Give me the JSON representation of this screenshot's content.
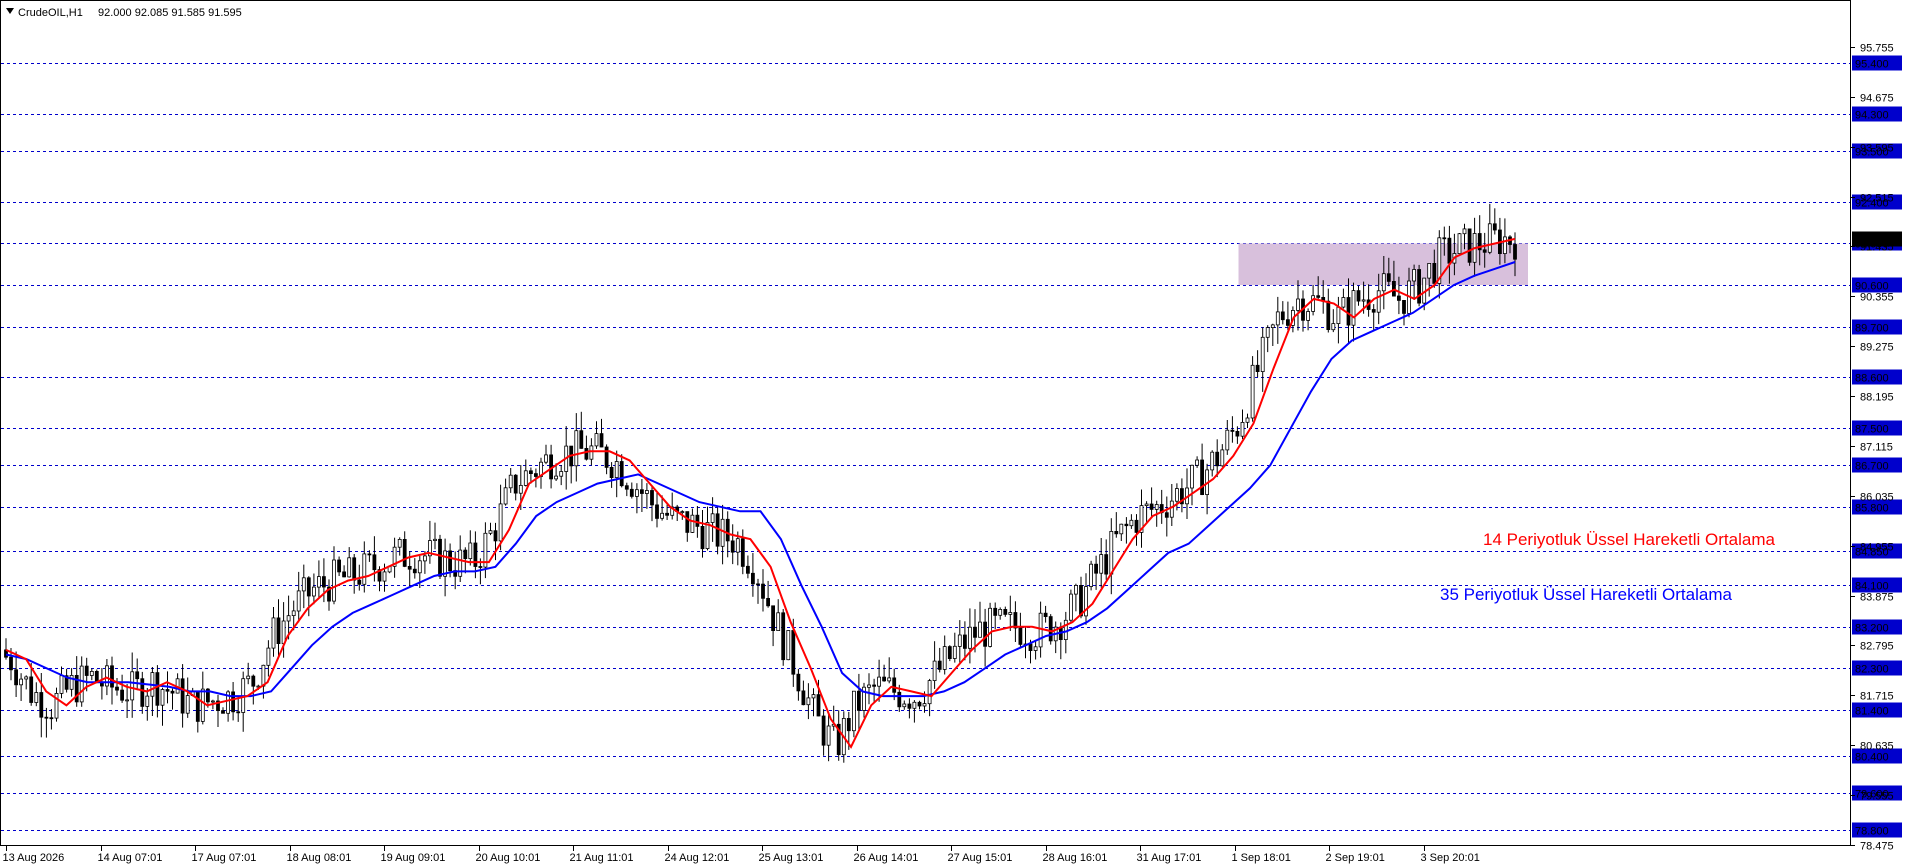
{
  "header": {
    "symbol": "CrudeOIL,H1",
    "ohlc": "92.000 92.085 91.585 91.595"
  },
  "colors": {
    "background": "#ffffff",
    "candle": "#000000",
    "ema_fast": "#ff0000",
    "ema_slow": "#0000ff",
    "level_line": "#0000cc",
    "level_tag_bg": "#0000cc",
    "level_tag_text": "#ffffff",
    "zone_fill": "#d8c0dc"
  },
  "annotations": [
    {
      "text": "14 Periyotluk Üssel Hareketli Ortalama",
      "color": "#ff0000"
    },
    {
      "text": "35 Periyotluk Üssel Hareketli Ortalama",
      "color": "#0000ff"
    }
  ],
  "chart_data": {
    "type": "candlestick",
    "title": "CrudeOIL,H1",
    "ylim": [
      78.2,
      96.5
    ],
    "grid": false,
    "price_ticks": [
      "95.755",
      "94.675",
      "93.595",
      "92.515",
      "91.435",
      "90.355",
      "89.275",
      "88.195",
      "87.115",
      "86.035",
      "84.955",
      "83.875",
      "82.795",
      "81.715",
      "80.635",
      "79.555",
      "78.475"
    ],
    "levels": [
      "95.400",
      "94.300",
      "93.500",
      "92.400",
      "91.500",
      "90.600",
      "89.700",
      "88.600",
      "87.500",
      "86.700",
      "85.800",
      "84.850",
      "84.100",
      "83.200",
      "82.300",
      "81.400",
      "80.400",
      "79.600",
      "78.800"
    ],
    "current_price": "91.595",
    "time_labels": [
      "13 Aug 2026",
      "14 Aug 07:01",
      "17 Aug 07:01",
      "18 Aug 08:01",
      "19 Aug 09:01",
      "20 Aug 10:01",
      "21 Aug 11:01",
      "24 Aug 12:01",
      "25 Aug 13:01",
      "26 Aug 14:01",
      "27 Aug 15:01",
      "28 Aug 16:01",
      "31 Aug 17:01",
      "1 Sep 18:01",
      "2 Sep 19:01",
      "3 Sep 20:01"
    ],
    "zone": {
      "from_price": 90.6,
      "to_price": 91.5,
      "start": "1 Sep 18:01",
      "end": "3 Sep 20:01"
    },
    "series": [
      {
        "name": "14 Periyotluk Üssel Hareketli Ortalama",
        "color": "#ff0000",
        "values": [
          82.7,
          82.5,
          81.8,
          81.5,
          81.9,
          82.1,
          81.9,
          81.8,
          82.0,
          81.8,
          81.5,
          81.6,
          81.7,
          82.0,
          83.0,
          83.6,
          84.0,
          84.2,
          84.3,
          84.5,
          84.7,
          84.8,
          84.7,
          84.6,
          84.6,
          85.3,
          86.3,
          86.6,
          86.9,
          87.0,
          87.0,
          86.8,
          86.3,
          85.8,
          85.5,
          85.4,
          85.2,
          85.1,
          84.5,
          83.3,
          82.3,
          81.2,
          80.6,
          81.5,
          81.9,
          81.8,
          81.7,
          82.2,
          82.7,
          83.1,
          83.2,
          83.2,
          83.1,
          83.3,
          83.7,
          84.4,
          85.1,
          85.6,
          85.8,
          86.1,
          86.4,
          86.9,
          87.6,
          88.8,
          89.9,
          90.3,
          90.2,
          89.9,
          90.3,
          90.5,
          90.3,
          90.6,
          91.2,
          91.4,
          91.5,
          91.6
        ]
      },
      {
        "name": "35 Periyotluk Üssel Hareketli Ortalama",
        "color": "#0000ff",
        "values": [
          82.6,
          82.5,
          82.3,
          82.1,
          82.0,
          82.0,
          82.0,
          81.95,
          81.9,
          81.8,
          81.8,
          81.7,
          81.7,
          81.8,
          82.3,
          82.8,
          83.2,
          83.5,
          83.7,
          83.9,
          84.1,
          84.3,
          84.4,
          84.4,
          84.5,
          85.0,
          85.6,
          85.9,
          86.1,
          86.3,
          86.4,
          86.5,
          86.3,
          86.1,
          85.9,
          85.8,
          85.7,
          85.7,
          85.1,
          84.1,
          83.2,
          82.2,
          81.8,
          81.7,
          81.7,
          81.7,
          81.8,
          82.0,
          82.3,
          82.6,
          82.8,
          83.0,
          83.1,
          83.3,
          83.6,
          84.0,
          84.4,
          84.8,
          85.0,
          85.4,
          85.8,
          86.2,
          86.7,
          87.5,
          88.3,
          89.0,
          89.4,
          89.6,
          89.8,
          90.0,
          90.3,
          90.6,
          90.8,
          90.95,
          91.1
        ]
      }
    ]
  }
}
